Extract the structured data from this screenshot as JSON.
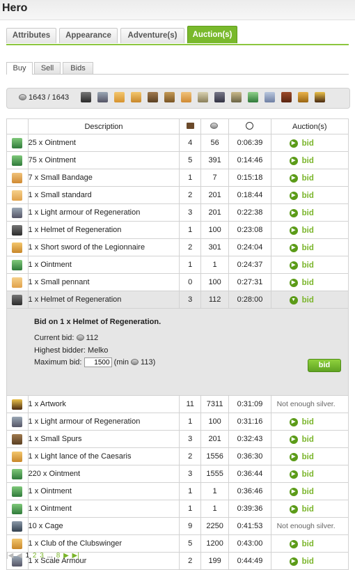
{
  "header": {
    "title": "Hero"
  },
  "main_tabs": [
    {
      "label": "Attributes"
    },
    {
      "label": "Appearance"
    },
    {
      "label": "Adventure(s)"
    },
    {
      "label": "Auction(s)"
    }
  ],
  "sub_tabs": [
    {
      "label": "Buy"
    },
    {
      "label": "Sell"
    },
    {
      "label": "Bids"
    }
  ],
  "resources": {
    "silver": "1643 / 1643",
    "filter_icons": [
      "helmet-icon",
      "armour-icon",
      "left-hand-icon",
      "right-hand-icon",
      "boots-icon",
      "horse-icon",
      "bandage-icon",
      "cage-icon",
      "scroll-icon",
      "ointment-icon",
      "bucket-icon",
      "book-icon",
      "tablet-icon",
      "artwork-icon"
    ]
  },
  "table": {
    "headers": {
      "description": "Description",
      "auctions": "Auction(s)"
    },
    "rows": [
      {
        "icon": "ointment-icon",
        "desc": "25 x Ointment",
        "bids": "4",
        "price": "56",
        "time": "0:06:39",
        "action": "bid"
      },
      {
        "icon": "ointment-icon",
        "desc": "75 x Ointment",
        "bids": "5",
        "price": "391",
        "time": "0:14:46",
        "action": "bid"
      },
      {
        "icon": "bandage-icon",
        "desc": "7 x Small Bandage",
        "bids": "1",
        "price": "7",
        "time": "0:15:18",
        "action": "bid"
      },
      {
        "icon": "left-hand-icon",
        "desc": "1 x Small standard",
        "bids": "2",
        "price": "201",
        "time": "0:18:44",
        "action": "bid"
      },
      {
        "icon": "armour-icon",
        "desc": "1 x Light armour of Regeneration",
        "bids": "3",
        "price": "201",
        "time": "0:22:38",
        "action": "bid"
      },
      {
        "icon": "helmet-icon",
        "desc": "1 x Helmet of Regeneration",
        "bids": "1",
        "price": "100",
        "time": "0:23:08",
        "action": "bid"
      },
      {
        "icon": "right-hand-icon",
        "desc": "1 x Short sword of the Legionnaire",
        "bids": "2",
        "price": "301",
        "time": "0:24:04",
        "action": "bid"
      },
      {
        "icon": "ointment-icon",
        "desc": "1 x Ointment",
        "bids": "1",
        "price": "1",
        "time": "0:24:37",
        "action": "bid"
      },
      {
        "icon": "left-hand-icon",
        "desc": "1 x Small pennant",
        "bids": "0",
        "price": "100",
        "time": "0:27:31",
        "action": "bid"
      },
      {
        "icon": "helmet-icon",
        "desc": "1 x Helmet of Regeneration",
        "bids": "3",
        "price": "112",
        "time": "0:28:00",
        "action": "bid",
        "selected": true
      }
    ],
    "rows_after": [
      {
        "icon": "artwork-icon",
        "desc": "1 x Artwork",
        "bids": "11",
        "price": "7311",
        "time": "0:31:09",
        "action": "Not enough silver."
      },
      {
        "icon": "armour-icon",
        "desc": "1 x Light armour of Regeneration",
        "bids": "1",
        "price": "100",
        "time": "0:31:16",
        "action": "bid"
      },
      {
        "icon": "boots-icon",
        "desc": "1 x Small Spurs",
        "bids": "3",
        "price": "201",
        "time": "0:32:43",
        "action": "bid"
      },
      {
        "icon": "right-hand-icon",
        "desc": "1 x Light lance of the Caesaris",
        "bids": "2",
        "price": "1556",
        "time": "0:36:30",
        "action": "bid"
      },
      {
        "icon": "ointment-icon",
        "desc": "220 x Ointment",
        "bids": "3",
        "price": "1555",
        "time": "0:36:44",
        "action": "bid"
      },
      {
        "icon": "ointment-icon",
        "desc": "1 x Ointment",
        "bids": "1",
        "price": "1",
        "time": "0:36:46",
        "action": "bid"
      },
      {
        "icon": "ointment-icon",
        "desc": "1 x Ointment",
        "bids": "1",
        "price": "1",
        "time": "0:39:36",
        "action": "bid"
      },
      {
        "icon": "cage-icon",
        "desc": "10 x Cage",
        "bids": "9",
        "price": "2250",
        "time": "0:41:53",
        "action": "Not enough silver."
      },
      {
        "icon": "right-hand-icon",
        "desc": "1 x Club of the Clubswinger",
        "bids": "5",
        "price": "1200",
        "time": "0:43:00",
        "action": "bid"
      },
      {
        "icon": "armour-icon",
        "desc": "1 x Scale Armour",
        "bids": "2",
        "price": "199",
        "time": "0:44:49",
        "action": "bid"
      }
    ]
  },
  "bid_panel": {
    "title": "Bid on 1 x Helmet of Regeneration.",
    "current_bid_label": "Current bid:",
    "current_bid": "112",
    "highest_bidder": "Highest bidder: Melko",
    "max_bid_label": "Maximum bid:",
    "max_bid_value": "1500",
    "min_prefix": "(min",
    "min_value": "113)",
    "button": "bid"
  },
  "pager": {
    "first": "1",
    "second": "2",
    "third": "3",
    "ellipsis": "...",
    "last": "8"
  },
  "colors": {
    "accent": "#79b92c",
    "bid_text": "#7ab52a"
  }
}
